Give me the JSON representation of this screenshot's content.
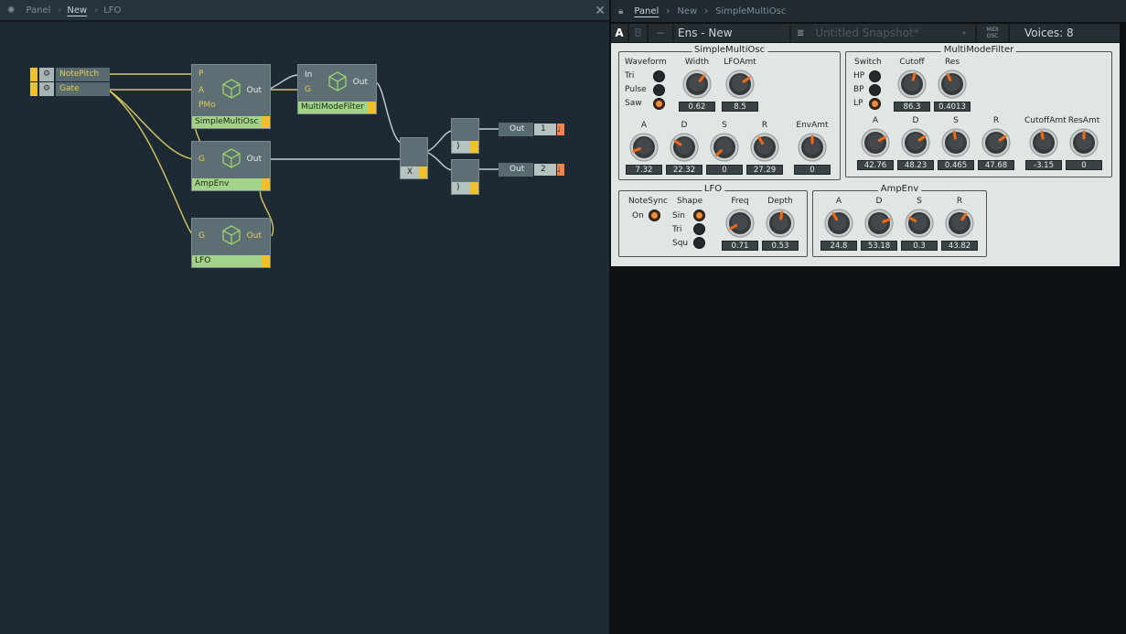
{
  "left": {
    "breadcrumb": [
      "Panel",
      "New",
      "LFO"
    ],
    "active_crumb": "New",
    "bug_icon": "bug-icon",
    "close": "✕",
    "inputs": [
      {
        "label": "NotePitch"
      },
      {
        "label": "Gate"
      }
    ],
    "nodes": {
      "osc": {
        "title": "SimpleMultiOsc",
        "ports_in": [
          "P",
          "A",
          "PMo"
        ],
        "port_out": "Out"
      },
      "filter": {
        "title": "MultiModeFilter",
        "ports_in": [
          "In",
          "G"
        ],
        "port_out": "Out"
      },
      "ampenv": {
        "title": "AmpEnv",
        "ports_in": [
          "G"
        ],
        "port_out": "Out"
      },
      "lfo": {
        "title": "LFO",
        "ports_in": [
          "G"
        ],
        "port_out": "Out"
      },
      "mult": {
        "title": "X"
      },
      "split1": {
        "title": ")"
      },
      "split2": {
        "title": ")"
      }
    },
    "outputs": [
      {
        "label": "Out",
        "channel": "1"
      },
      {
        "label": "Out",
        "channel": "2"
      }
    ]
  },
  "right": {
    "breadcrumb": [
      "Panel",
      "New",
      "SimpleMultiOsc"
    ],
    "active_crumb": "Panel",
    "toolbar": {
      "a": "A",
      "b": "B",
      "minus": "−",
      "ensemble": "Ens - New",
      "snapshot": "Untitled Snapshot*",
      "midi": "MIDI",
      "osc": "OSC",
      "voices": "Voices: 8"
    },
    "groups": {
      "osc": {
        "title": "SimpleMultiOsc",
        "waveform_label": "Waveform",
        "waveforms": [
          "Tri",
          "Pulse",
          "Saw"
        ],
        "selected": "Saw",
        "knobs": [
          {
            "label": "Width",
            "value": "0.62",
            "angle": 40
          },
          {
            "label": "LFOAmt",
            "value": "8.5",
            "angle": 55
          },
          {
            "label": "A",
            "value": "7.32",
            "angle": -110
          },
          {
            "label": "D",
            "value": "22.32",
            "angle": -55
          },
          {
            "label": "S",
            "value": "0",
            "angle": -135
          },
          {
            "label": "R",
            "value": "27.29",
            "angle": -30
          },
          {
            "label": "EnvAmt",
            "value": "0",
            "angle": 0
          }
        ]
      },
      "filter": {
        "title": "MultiModeFilter",
        "switch_label": "Switch",
        "modes": [
          "HP",
          "BP",
          "LP"
        ],
        "selected": "LP",
        "knobs": [
          {
            "label": "Cutoff",
            "value": "86.3",
            "angle": 15
          },
          {
            "label": "Res",
            "value": "0.4013",
            "angle": -25
          },
          {
            "label": "A",
            "value": "42.76",
            "angle": 60
          },
          {
            "label": "D",
            "value": "48.23",
            "angle": 55
          },
          {
            "label": "S",
            "value": "0.465",
            "angle": -8
          },
          {
            "label": "R",
            "value": "47.68",
            "angle": 55
          },
          {
            "label": "CutoffAmt",
            "value": "-3.15",
            "angle": -10
          },
          {
            "label": "ResAmt",
            "value": "0",
            "angle": 0
          }
        ]
      },
      "lfo": {
        "title": "LFO",
        "notesync_label": "NoteSync",
        "notesync": "On",
        "shape_label": "Shape",
        "shapes": [
          "Sin",
          "Tri",
          "Squ"
        ],
        "selected": "Sin",
        "knobs": [
          {
            "label": "Freq",
            "value": "0.71",
            "angle": -120
          },
          {
            "label": "Depth",
            "value": "0.53",
            "angle": 8
          }
        ]
      },
      "ampenv": {
        "title": "AmpEnv",
        "knobs": [
          {
            "label": "A",
            "value": "24.8",
            "angle": -30
          },
          {
            "label": "D",
            "value": "53.18",
            "angle": 70
          },
          {
            "label": "S",
            "value": "0.3",
            "angle": -60
          },
          {
            "label": "R",
            "value": "43.82",
            "angle": 35
          }
        ]
      }
    },
    "colors": {
      "accent": "#f28b3c",
      "panel": "#e0e6e4",
      "node": "#5d6e74",
      "title_bar": "#a2d388",
      "wire_gate": "#d8c860"
    }
  }
}
